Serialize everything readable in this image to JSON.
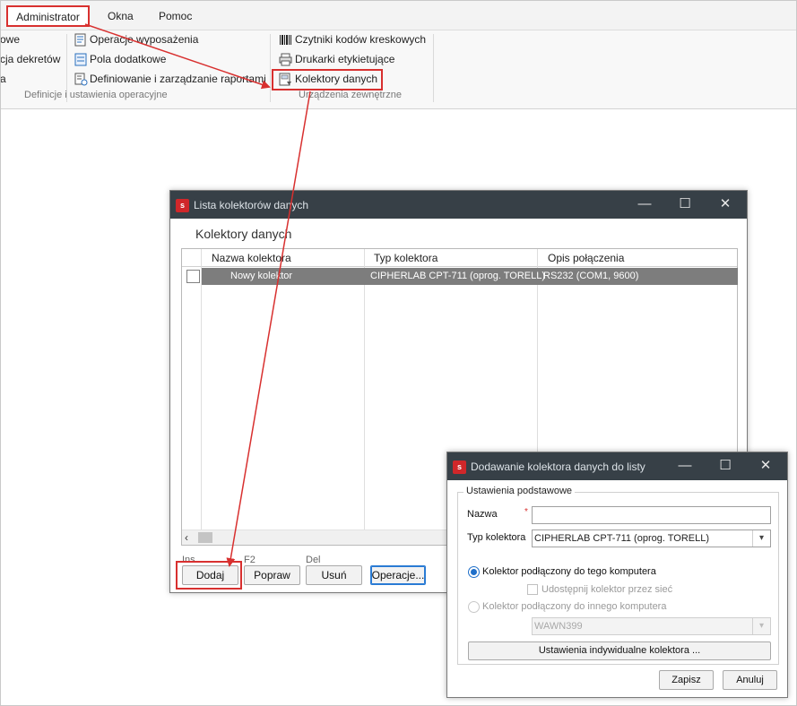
{
  "menu": {
    "administrator": "Administrator",
    "okna": "Okna",
    "pomoc": "Pomoc"
  },
  "ribbon": {
    "partial_col": [
      "owe",
      "cja dekretów",
      "a"
    ],
    "group1_items": [
      "Operacje wyposażenia",
      "Pola dodatkowe",
      "Definiowanie i zarządzanie raportami"
    ],
    "group1_label": "Definicje i ustawienia operacyjne",
    "group2_items": [
      "Czytniki kodów kreskowych",
      "Drukarki etykietujące",
      "Kolektory danych"
    ],
    "group2_label": "Urządzenia zewnętrzne"
  },
  "window1": {
    "title": "Lista kolektorów danych",
    "heading": "Kolektory danych",
    "columns": [
      "Nazwa kolektora",
      "Typ kolektora",
      "Opis połączenia"
    ],
    "rows": [
      {
        "name": "Nowy kolektor",
        "type": "CIPHERLAB CPT-711 (oprog. TORELL)",
        "connection": "RS232 (COM1,  9600)"
      }
    ],
    "hints": {
      "ins": "Ins",
      "f2": "F2",
      "del": "Del"
    },
    "buttons": {
      "dodaj": "Dodaj",
      "popraw": "Popraw",
      "usun": "Usuń",
      "operacje": "Operacje..."
    }
  },
  "window2": {
    "title": "Dodawanie kolektora danych do listy",
    "group_label": "Ustawienia podstawowe",
    "nazwa_label": "Nazwa",
    "required_mark": "*",
    "nazwa_value": "",
    "typ_label": "Typ kolektora",
    "typ_value": "CIPHERLAB CPT-711 (oprog. TORELL)",
    "radio_local": "Kolektor podłączony do tego komputera",
    "share_checkbox": "Udostępnij kolektor przez sieć",
    "radio_remote": "Kolektor podłączony do innego komputera",
    "computer_value": "WAWN399",
    "individual_settings_button": "Ustawienia indywidualne kolektora ...",
    "zapisz": "Zapisz",
    "anuluj": "Anuluj"
  },
  "colors": {
    "accent_red": "#d8302f",
    "titlebar": "#374047",
    "selected_row": "#7d7d7d",
    "focus_blue": "#2a7bd4"
  }
}
